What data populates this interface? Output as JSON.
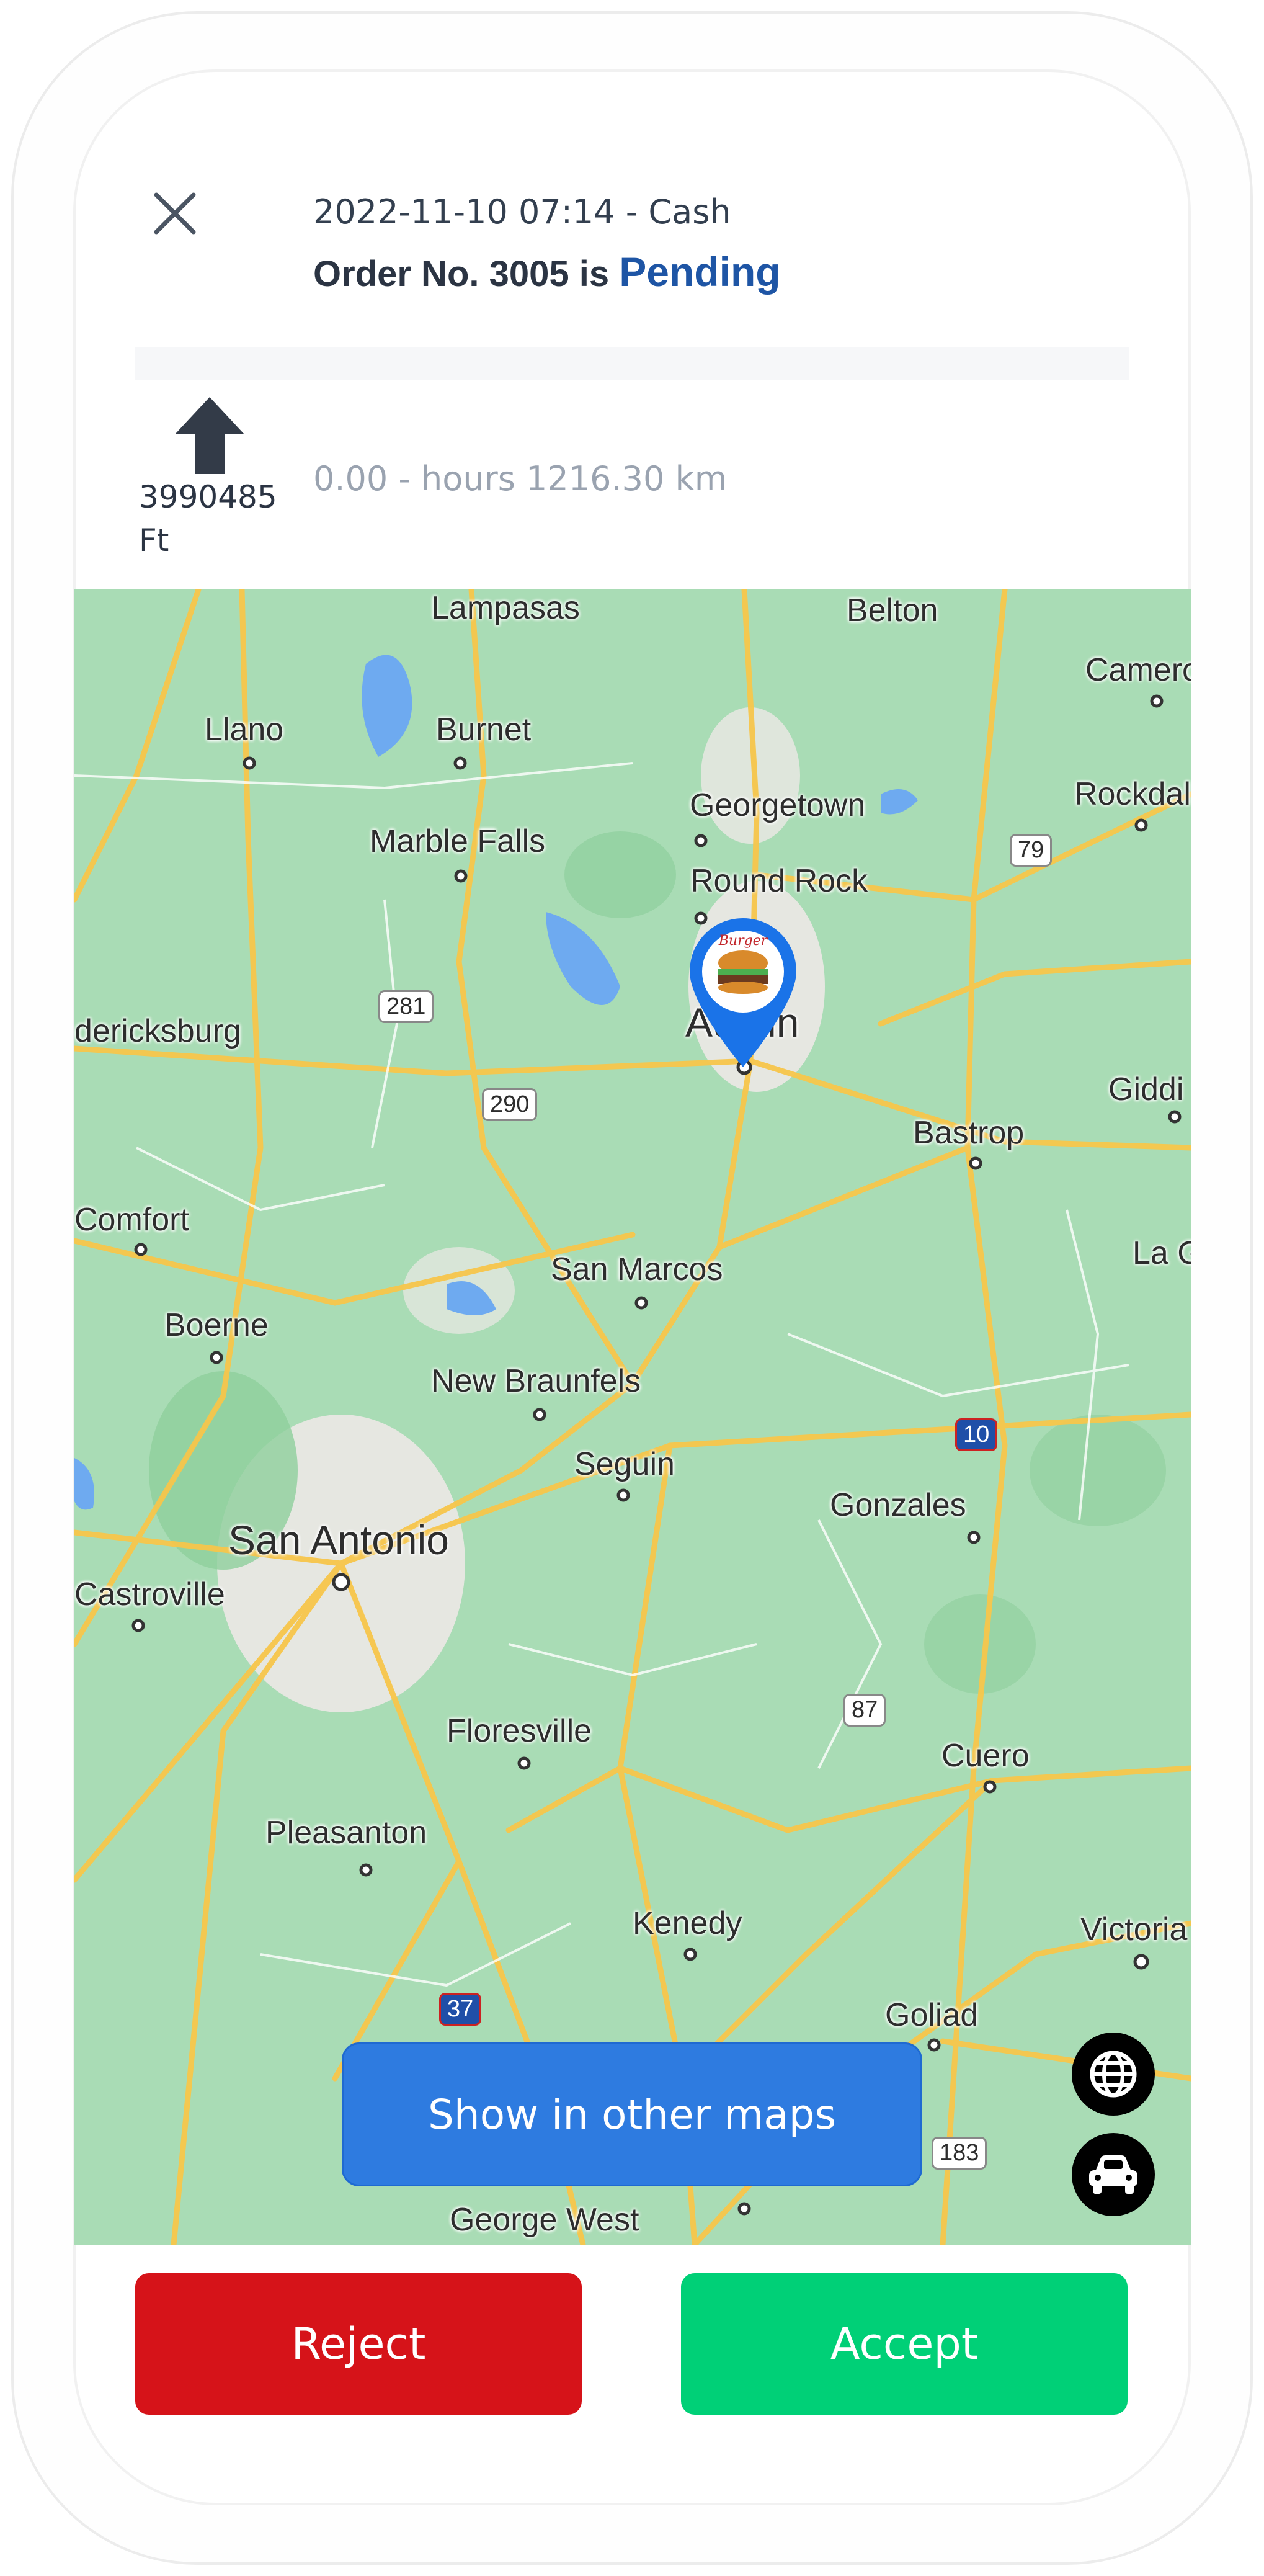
{
  "header": {
    "meta": "2022-11-10 07:14 - Cash",
    "order_prefix": "Order No. 3005 is",
    "status": "Pending",
    "status_color": "#1e55a5"
  },
  "navigation": {
    "distance": "3990485 Ft",
    "eta": "0.00 - hours 1216.30 km",
    "direction_icon": "arrow-up-icon"
  },
  "map": {
    "places": {
      "lampasas": "Lampasas",
      "belton": "Belton",
      "cameron": "Camero",
      "llano": "Llano",
      "burnet": "Burnet",
      "georgetown": "Georgetown",
      "rockdale": "Rockdal",
      "marble_falls": "Marble Falls",
      "round_rock": "Round Rock",
      "fredericksburg": "dericksburg",
      "austin": "Austin",
      "giddings": "Giddi",
      "bastrop": "Bastrop",
      "comfort": "Comfort",
      "la_grange": "La G",
      "san_marcos": "San Marcos",
      "boerne": "Boerne",
      "new_braunfels": "New Braunfels",
      "seguin": "Seguin",
      "gonzales": "Gonzales",
      "san_antonio": "San Antonio",
      "castroville": "Castroville",
      "floresville": "Floresville",
      "cuero": "Cuero",
      "pleasanton": "Pleasanton",
      "kenedy": "Kenedy",
      "victoria": "Victoria",
      "goliad": "Goliad",
      "george_west": "George West"
    },
    "shields": {
      "us79": "79",
      "us281": "281",
      "us290": "290",
      "i10": "10",
      "us87": "87",
      "us183": "183",
      "i37": "37"
    },
    "pin_label": "Burger"
  },
  "actions": {
    "show_in_other_maps": "Show in other maps",
    "reject": "Reject",
    "accept": "Accept",
    "reject_color": "#d61319",
    "accept_color": "#00d077"
  }
}
